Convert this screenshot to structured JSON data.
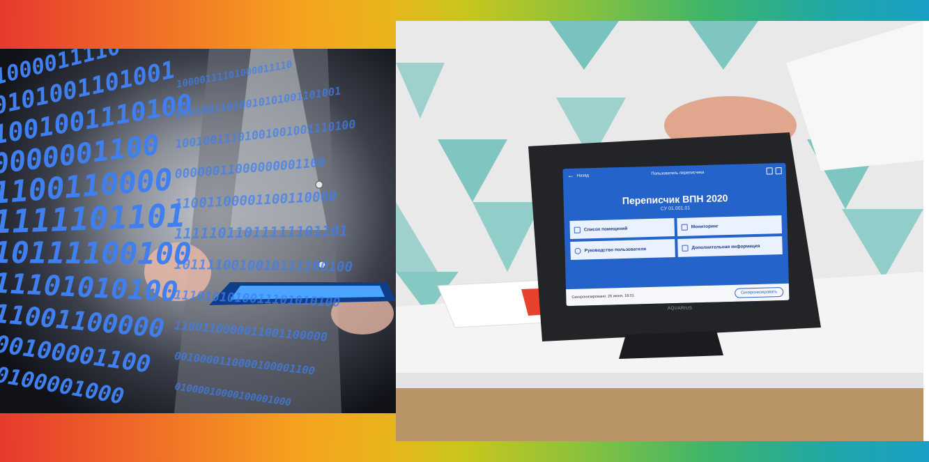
{
  "colors": {
    "band_start": "#e63a2e",
    "band_mid": "#f6a21f",
    "band_end": "#1aa0c8",
    "screen_blue": "#2463c9",
    "binary_blue": "#3f7ff0"
  },
  "left_photo": {
    "binary_rows": [
      "1000011110",
      "0101001101001",
      "1001001110100",
      "0000001100",
      "1100110000",
      "1111101101",
      "10111100100",
      "11101010100",
      "11001100000",
      "00100001100",
      "0100001000"
    ]
  },
  "tablet": {
    "back_label": "Назад",
    "top_title": "Пользователь переписчика",
    "app_title": "Переписчик ВПН 2020",
    "subtitle": "СУ 01.001.01",
    "buttons": [
      {
        "label": "Список помещений",
        "icon": "list-icon"
      },
      {
        "label": "Мониторинг",
        "icon": "chart-icon"
      },
      {
        "label": "Руководство пользователя",
        "icon": "help-icon"
      },
      {
        "label": "Дополнительная информация",
        "icon": "info-icon"
      }
    ],
    "sync_status": "Синхронизировано: 26 июня, 18:01",
    "sync_button": "Синхронизировать",
    "brand": "AQUARIUS"
  }
}
